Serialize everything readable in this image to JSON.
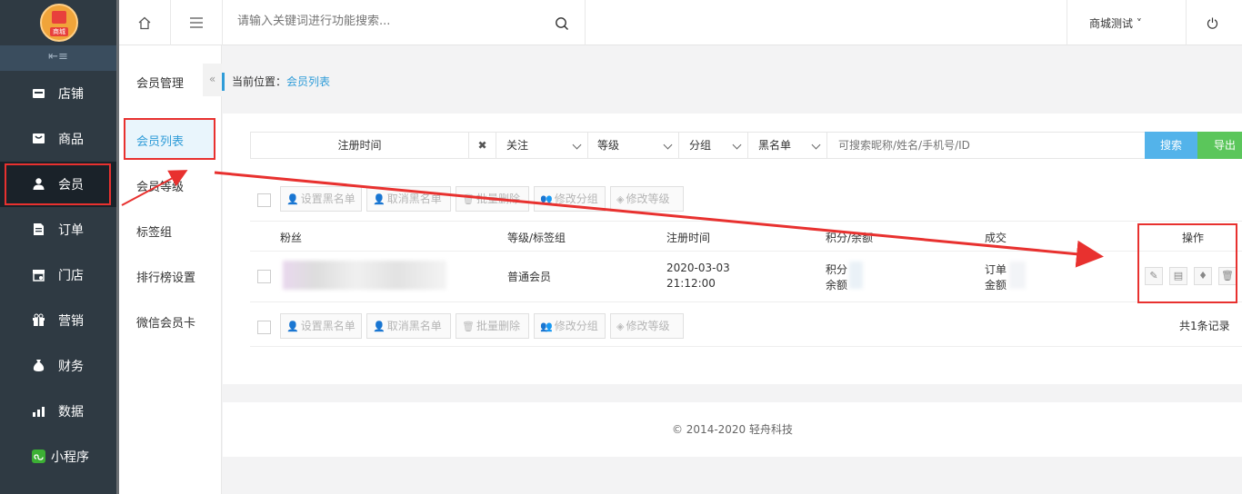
{
  "brand": {
    "logo_text": "商城"
  },
  "sidebar": {
    "collapse_glyph": "⇤≡",
    "items": [
      {
        "label": "店铺",
        "icon": "store-icon"
      },
      {
        "label": "商品",
        "icon": "goods-icon"
      },
      {
        "label": "会员",
        "icon": "user-icon",
        "active": true
      },
      {
        "label": "订单",
        "icon": "order-icon"
      },
      {
        "label": "门店",
        "icon": "shop-icon"
      },
      {
        "label": "营销",
        "icon": "gift-icon"
      },
      {
        "label": "财务",
        "icon": "money-bag-icon"
      },
      {
        "label": "数据",
        "icon": "chart-icon"
      },
      {
        "label": "小程序",
        "icon": "miniprogram-icon"
      }
    ]
  },
  "topbar": {
    "search_placeholder": "请输入关键词进行功能搜索...",
    "store_name": "商城测试 ˅"
  },
  "submenu": {
    "title": "会员管理",
    "toggle": "«",
    "items": [
      {
        "label": "会员列表",
        "active": true
      },
      {
        "label": "会员等级"
      },
      {
        "label": "标签组"
      },
      {
        "label": "排行榜设置"
      },
      {
        "label": "微信会员卡"
      }
    ]
  },
  "breadcrumb": {
    "prefix": "当前位置：",
    "current": "会员列表"
  },
  "filter": {
    "reg_time": "注册时间",
    "clear": "✖",
    "follow": "关注",
    "level": "等级",
    "group": "分组",
    "blacklist": "黑名单",
    "search_placeholder": "可搜索昵称/姓名/手机号/ID",
    "search_btn": "搜索",
    "export_btn": "导出"
  },
  "batch": {
    "set_black": "设置黑名单",
    "unset_black": "取消黑名单",
    "batch_delete": "批量删除",
    "edit_group": "修改分组",
    "edit_level": "修改等级"
  },
  "table": {
    "headers": [
      "粉丝",
      "等级/标签组",
      "注册时间",
      "积分/余额",
      "成交",
      "操作"
    ],
    "rows": [
      {
        "level": "普通会员",
        "reg_date": "2020-03-03",
        "reg_time": "21:12:00",
        "points_label": "积分",
        "balance_label": "余额",
        "orders_label": "订单",
        "amount_label": "金额"
      }
    ],
    "total": "共1条记录"
  },
  "footer": {
    "copyright": "© 2014-2020 轻舟科技"
  },
  "colors": {
    "accent": "#2f9cd8",
    "annotation": "#e8312f",
    "search_btn": "#53b3ea",
    "export_btn": "#5bc65b"
  }
}
